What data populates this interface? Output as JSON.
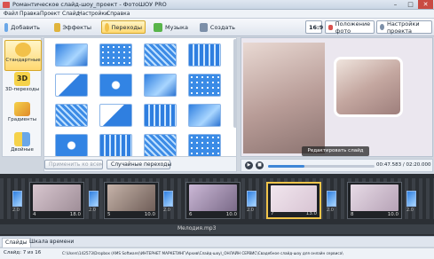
{
  "window": {
    "title": "Романтическое слайд-шоу_проект - ФотоШОУ PRO"
  },
  "menu": [
    "Файл",
    "Правка",
    "Проект",
    "Слайд",
    "Настройки",
    "Справка"
  ],
  "toolbar": {
    "tabs": [
      {
        "label": "Добавить"
      },
      {
        "label": "Эффекты"
      },
      {
        "label": "Переходы"
      },
      {
        "label": "Музыка"
      },
      {
        "label": "Создать"
      }
    ],
    "aspect": "16:9",
    "photo_position": "Положение фото",
    "project_settings": "Настройки проекта"
  },
  "categories": [
    {
      "label": "Стандартные"
    },
    {
      "label": "3D-переходы"
    },
    {
      "label": "Градиенты"
    },
    {
      "label": "Двойные"
    }
  ],
  "transitions_panel": {
    "apply_all": "Применить ко всем",
    "random": "Случайные переходы"
  },
  "preview": {
    "edit_slide": "Редактировать слайд",
    "time": "00:47.583 / 02:20.000"
  },
  "timeline": {
    "slides": [
      {
        "num": "4",
        "duration": "18.0"
      },
      {
        "num": "5",
        "duration": "10.0"
      },
      {
        "num": "6",
        "duration": "10.0"
      },
      {
        "num": "7",
        "duration": "13.0"
      },
      {
        "num": "8",
        "duration": "10.0"
      }
    ],
    "transition_durations": [
      "2.0",
      "2.0",
      "2.0",
      "2.0",
      "2.0",
      "2.0"
    ],
    "music": "Мелодия.mp3"
  },
  "bottom_tabs": [
    {
      "label": "Слайды"
    },
    {
      "label": "Шкала времени"
    }
  ],
  "status": {
    "slide": "Слайд: 7 из 16",
    "path": "C:\\Users\\142573\\Dropbox (AMS Software)\\ИНТЕРНЕТ МАРКЕТИНГ\\Архив\\Слайд-шоу\\_ОНЛАЙН СЕРВИС\\Свадебное слайд-шоу для онлайн сервиса\\"
  },
  "progress_fraction": 0.34
}
